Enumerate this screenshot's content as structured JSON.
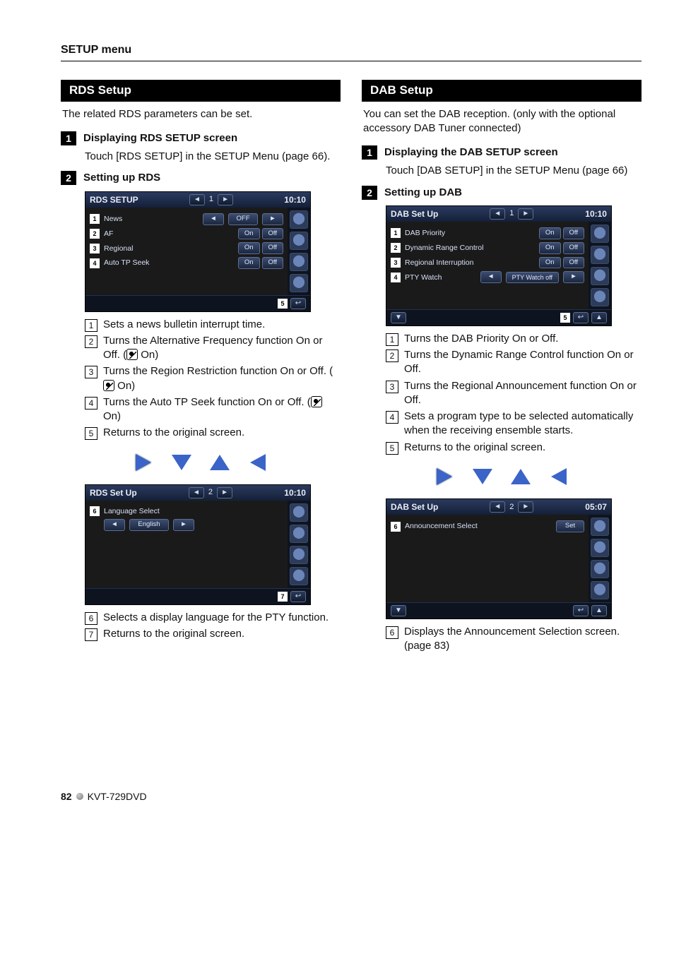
{
  "page": {
    "section_title": "SETUP menu",
    "page_number": "82",
    "product": "KVT-729DVD"
  },
  "left": {
    "bar": "RDS Setup",
    "intro": "The related RDS parameters can be set.",
    "step1_num": "1",
    "step1_label": "Displaying RDS SETUP screen",
    "step1_body": "Touch [RDS SETUP] in the SETUP Menu (page 66).",
    "step2_num": "2",
    "step2_label": "Setting up RDS",
    "shotA": {
      "title": "RDS SETUP",
      "center": "1",
      "clock": "10:10",
      "rows": [
        {
          "n": "1",
          "label": "News",
          "value": "OFF",
          "type": "arrows"
        },
        {
          "n": "2",
          "label": "AF",
          "type": "onoff"
        },
        {
          "n": "3",
          "label": "Regional",
          "type": "onoff"
        },
        {
          "n": "4",
          "label": "Auto TP Seek",
          "type": "onoff"
        }
      ],
      "return_n": "5"
    },
    "items1": {
      "i1_n": "1",
      "i1": "Sets a news bulletin interrupt time.",
      "i2_n": "2",
      "i2a": "Turns the Alternative Frequency function On or Off. (",
      "i2b": " On)",
      "i3_n": "3",
      "i3a": "Turns the Region Restriction function On or Off. (",
      "i3b": " On)",
      "i4_n": "4",
      "i4a": "Turns the Auto TP Seek function On or Off. (",
      "i4b": " On)",
      "i5_n": "5",
      "i5": "Returns to the original screen."
    },
    "shotB": {
      "title": "RDS Set Up",
      "center": "2",
      "clock": "10:10",
      "row_n": "6",
      "row_label": "Language Select",
      "row_value": "English",
      "return_n": "7"
    },
    "items2": {
      "i6_n": "6",
      "i6": "Selects a display language for the PTY function.",
      "i7_n": "7",
      "i7": "Returns to the original screen."
    }
  },
  "right": {
    "bar": "DAB Setup",
    "intro": "You can set the DAB reception. (only with the optional accessory DAB Tuner connected)",
    "step1_num": "1",
    "step1_label": "Displaying the DAB SETUP screen",
    "step1_body": "Touch [DAB SETUP] in the  SETUP Menu (page 66)",
    "step2_num": "2",
    "step2_label": "Setting up DAB",
    "shotA": {
      "title": "DAB Set Up",
      "center": "1",
      "clock": "10:10",
      "rows": [
        {
          "n": "1",
          "label": "DAB Priority",
          "type": "onoff"
        },
        {
          "n": "2",
          "label": "Dynamic Range Control",
          "type": "onoff"
        },
        {
          "n": "3",
          "label": "Regional Interruption",
          "type": "onoff"
        },
        {
          "n": "4",
          "label": "PTY Watch",
          "value": "PTY Watch off",
          "type": "arrows"
        }
      ],
      "return_n": "5"
    },
    "items1": {
      "i1_n": "1",
      "i1": "Turns the DAB Priority On or Off.",
      "i2_n": "2",
      "i2": "Turns the Dynamic Range Control function On or Off.",
      "i3_n": "3",
      "i3": "Turns the Regional Announcement function On or Off.",
      "i4_n": "4",
      "i4": "Sets a program type to be selected automatically when the receiving ensemble starts.",
      "i5_n": "5",
      "i5": "Returns to the original screen."
    },
    "shotB": {
      "title": "DAB Set Up",
      "center": "2",
      "clock": "05:07",
      "row_n": "6",
      "row_label": "Announcement Select",
      "row_btn": "Set"
    },
    "items2": {
      "i6_n": "6",
      "i6": "Displays the Announcement Selection screen. (page 83)"
    }
  },
  "onoff": {
    "on": "On",
    "off": "Off"
  }
}
